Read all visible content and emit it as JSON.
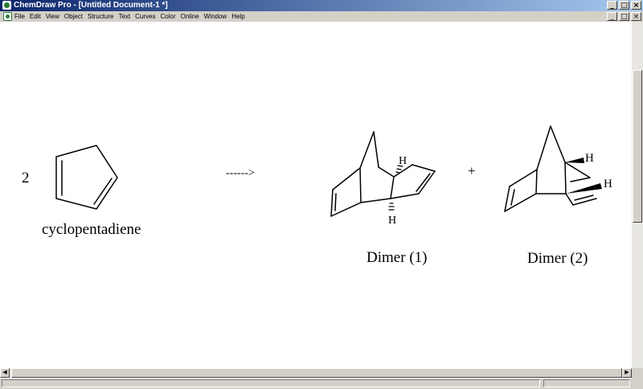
{
  "window": {
    "title": "ChemDraw Pro - [Untitled Document-1 *]",
    "buttons": [
      "_",
      "□",
      "×"
    ]
  },
  "menubar": {
    "items": [
      "File",
      "Edit",
      "View",
      "Object",
      "Structure",
      "Text",
      "Curves",
      "Color",
      "Online",
      "Window",
      "Help"
    ],
    "buttons": [
      "_",
      "□",
      "×"
    ]
  },
  "canvas": {
    "coefficient": "2",
    "reactant_label": "cyclopentadiene",
    "arrow": "------>",
    "plus": "+",
    "dimer1_label": "Dimer (1)",
    "dimer2_label": "Dimer (2)",
    "h_label": "H"
  }
}
